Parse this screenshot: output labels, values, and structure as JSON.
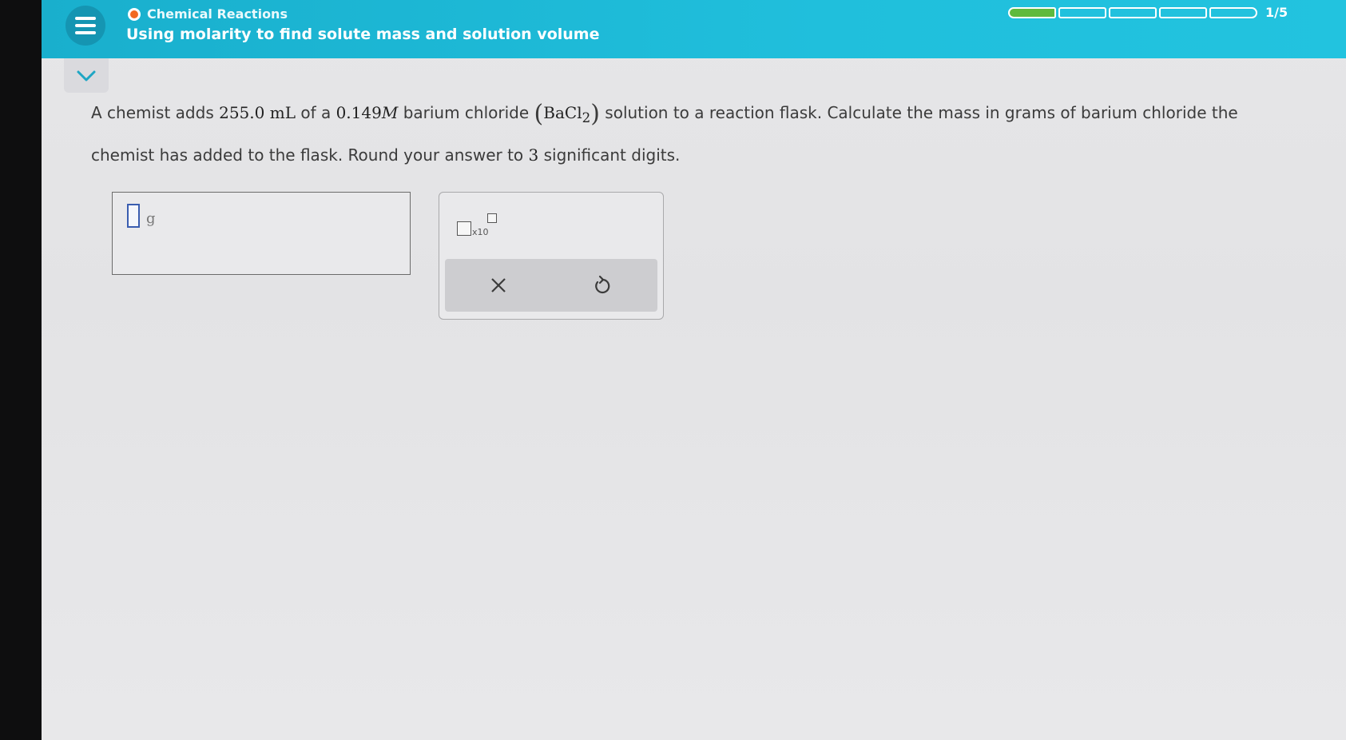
{
  "header": {
    "topic": "Chemical Reactions",
    "lesson_title": "Using molarity to find solute mass and solution volume",
    "progress_label": "1/5",
    "progress": {
      "completed": 1,
      "total": 5
    },
    "accent_color": "#1fbad8",
    "progress_fill_color": "#5fba3e",
    "topic_dot_color": "#f26a21"
  },
  "question": {
    "part1": "A chemist adds",
    "volume": "255.0 mL",
    "part2": "of a",
    "molarity_value": "0.149",
    "molarity_unit": "M",
    "part3": "barium chloride",
    "formula_base": "BaCl",
    "formula_sub": "2",
    "part4": "solution to a reaction flask. Calculate the mass in grams of barium chloride the",
    "line2a": "chemist has added to the flask. Round your answer to",
    "digits": "3",
    "line2b": "significant digits."
  },
  "answer": {
    "value": "",
    "unit": "g"
  },
  "tools": {
    "sci_label": "x10",
    "clear_icon": "close-icon",
    "undo_icon": "undo-icon"
  }
}
